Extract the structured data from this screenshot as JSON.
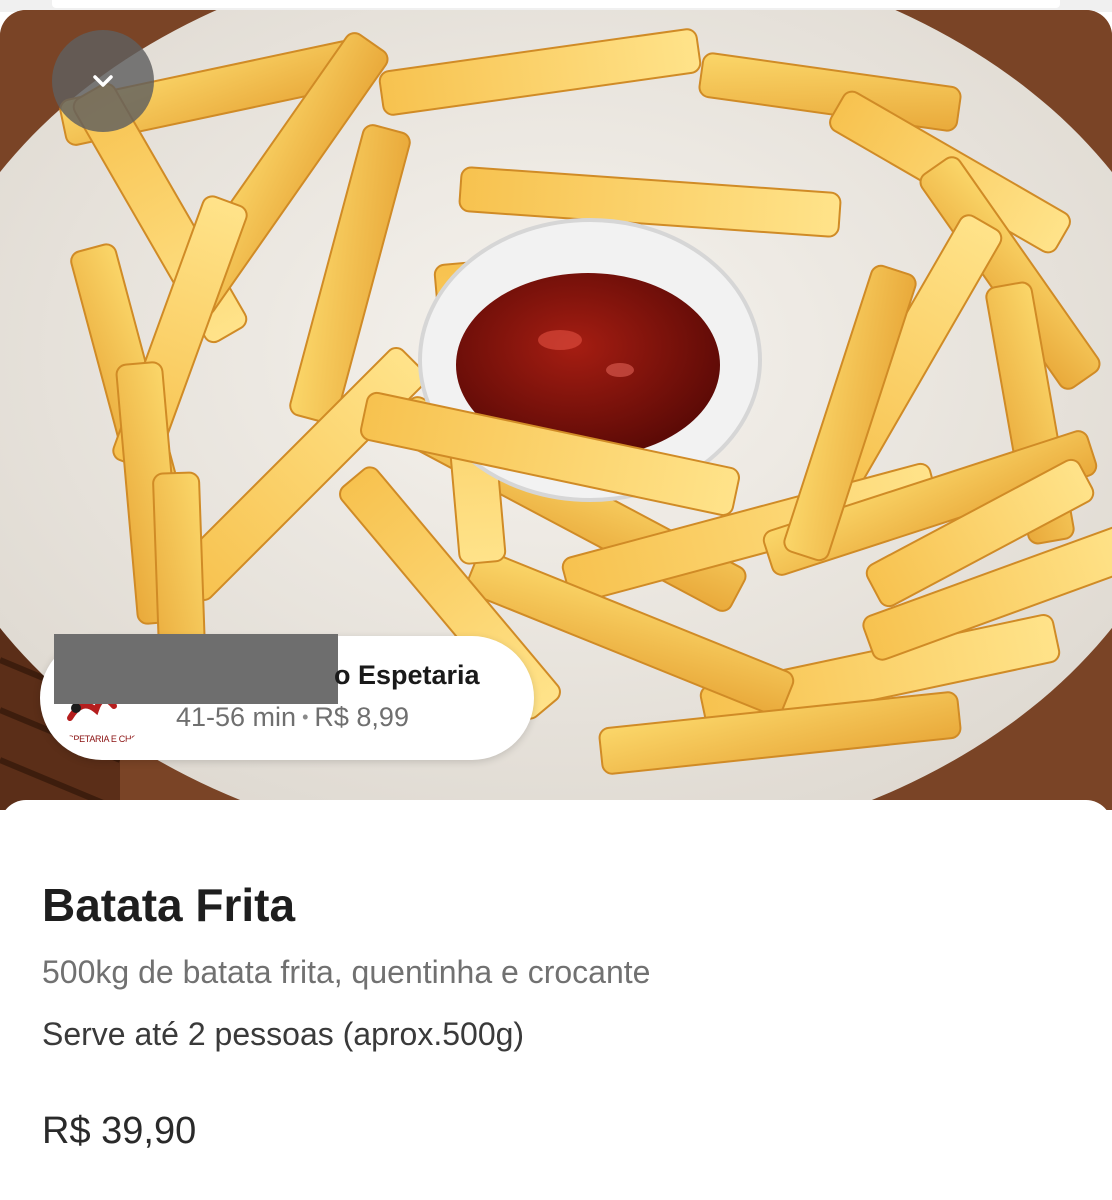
{
  "product": {
    "title": "Batata Frita",
    "description": "500kg de batata frita, quentinha e crocante",
    "serves": "Serve até 2 pessoas (aprox.500g)",
    "price": "R$ 39,90"
  },
  "store": {
    "name_visible": "o Espetaria",
    "delivery_time": "41-56 min",
    "separator": "•",
    "delivery_fee": "R$ 8,99",
    "logo_text": "ESPETARIA E CHOPER"
  },
  "icons": {
    "collapse": "chevron-down-icon"
  },
  "colors": {
    "overlay_button": "#5f5f5f",
    "text_primary": "#1e1e1e",
    "text_secondary": "#717171"
  }
}
